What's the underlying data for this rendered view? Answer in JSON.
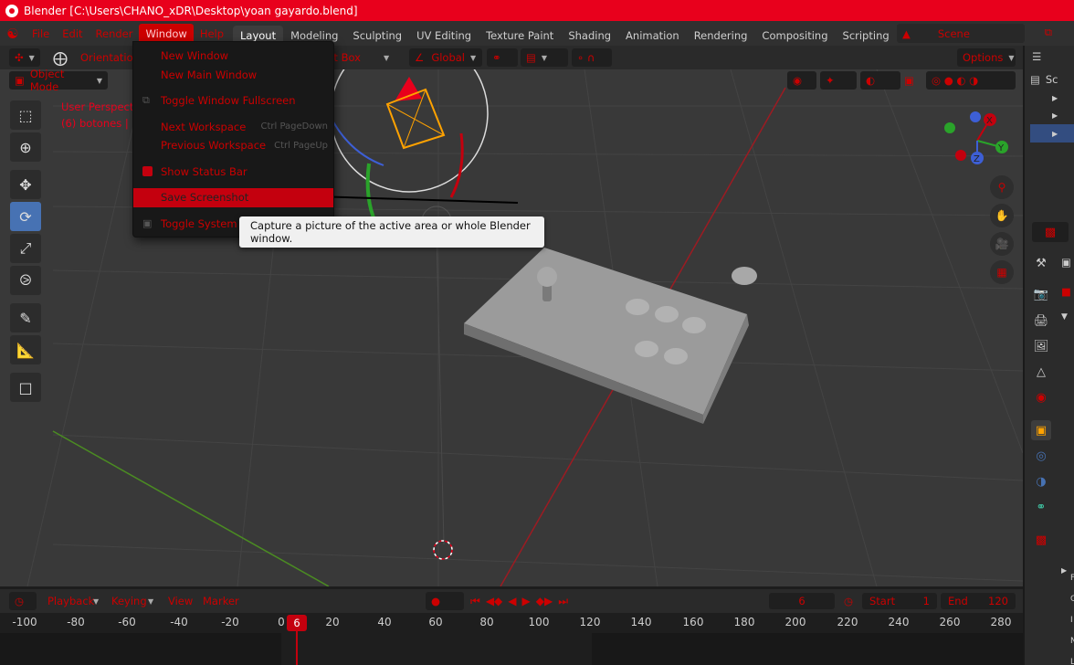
{
  "title_bar": {
    "text": "Blender [C:\\Users\\CHANO_xDR\\Desktop\\yoan gayardo.blend]"
  },
  "menu": {
    "items": [
      "File",
      "Edit",
      "Render",
      "Window",
      "Help"
    ]
  },
  "workspaces": [
    "Layout",
    "Modeling",
    "Sculpting",
    "UV Editing",
    "Texture Paint",
    "Shading",
    "Animation",
    "Rendering",
    "Compositing",
    "Scripting"
  ],
  "workspace_add": "+",
  "scene": {
    "label": "Scene"
  },
  "tool_header": {
    "orientation_label": "Orientation",
    "select_box": "ect Box",
    "transform_space": "Global",
    "options": "Options"
  },
  "viewport_header": {
    "mode": "Object Mode"
  },
  "viewport_overlay": {
    "line1": "User Perspectiv",
    "line2": "(6) botones | Ca"
  },
  "gizmo_axes": {
    "x": "X",
    "y": "Y",
    "z": "Z"
  },
  "window_menu": {
    "items": [
      {
        "label": "New Window",
        "shortcut": ""
      },
      {
        "label": "New Main Window",
        "shortcut": ""
      },
      {
        "label": "Toggle Window Fullscreen",
        "shortcut": ""
      },
      {
        "label": "Next Workspace",
        "shortcut": "Ctrl PageDown"
      },
      {
        "label": "Previous Workspace",
        "shortcut": "Ctrl PageUp"
      },
      {
        "label": "Show Status Bar",
        "shortcut": ""
      },
      {
        "label": "Save Screenshot",
        "shortcut": ""
      },
      {
        "label": "Toggle System C",
        "shortcut": ""
      }
    ]
  },
  "tooltip": {
    "text": "Capture a picture of the active area or whole Blender window."
  },
  "timeline": {
    "playback": "Playback",
    "keying": "Keying",
    "view": "View",
    "marker": "Marker",
    "current_frame": "6",
    "start_label": "Start",
    "start_value": "1",
    "end_label": "End",
    "end_value": "120",
    "ruler": [
      "-100",
      "-80",
      "-60",
      "-40",
      "-20",
      "0",
      "20",
      "40",
      "60",
      "80",
      "100",
      "120",
      "140",
      "160",
      "180",
      "200",
      "220",
      "240",
      "260",
      "280"
    ],
    "playhead_label": "6"
  },
  "outliner": {
    "row1": "Sc",
    "letters": [
      "F",
      "C",
      "I",
      "N",
      "L"
    ]
  },
  "colors": {
    "accent": "#c4000e",
    "title_bar": "#e8001c",
    "viewport_bg": "#393939",
    "tooltip_bg": "#f0f0f0"
  }
}
